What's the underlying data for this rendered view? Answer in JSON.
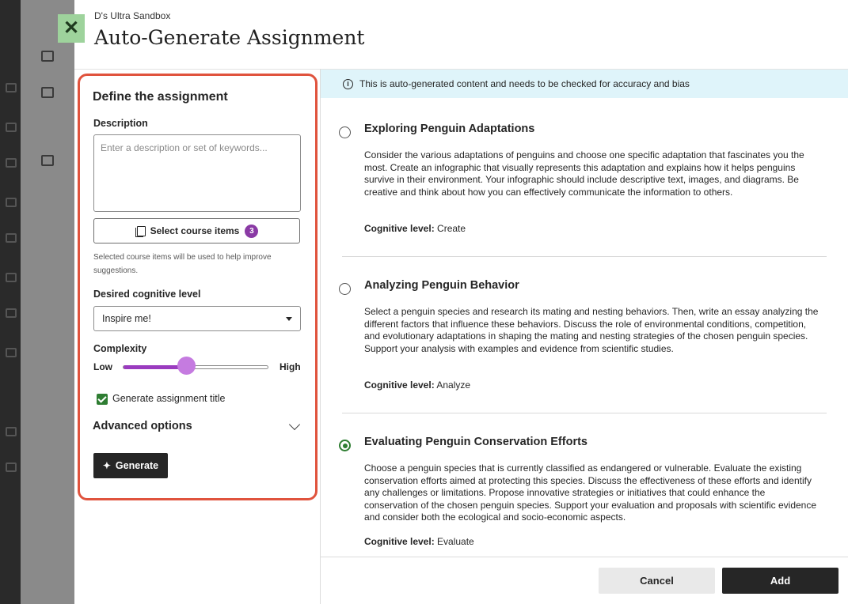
{
  "modal": {
    "course_name": "D's Ultra Sandbox",
    "title": "Auto-Generate Assignment"
  },
  "form": {
    "heading": "Define the assignment",
    "description_label": "Description",
    "description_placeholder": "Enter a description or set of keywords...",
    "description_value": "",
    "select_items_label": "Select course items",
    "select_items_count": "3",
    "helper_text": "Selected course items will be used to help improve suggestions.",
    "cognitive_label": "Desired cognitive level",
    "cognitive_value": "Inspire me!",
    "complexity_label": "Complexity",
    "complexity_low": "Low",
    "complexity_high": "High",
    "complexity_level": 0.44,
    "generate_title_label": "Generate assignment title",
    "generate_title_checked": true,
    "advanced_label": "Advanced options",
    "generate_button": "Generate"
  },
  "notice": {
    "text": "This is auto-generated content and needs to be checked for accuracy and bias",
    "icon": "info-icon"
  },
  "suggestions": [
    {
      "title": "Exploring Penguin Adaptations",
      "body": "Consider the various adaptations of penguins and choose one specific adaptation that fascinates you the most. Create an infographic that visually represents this adaptation and explains how it helps penguins survive in their environment. Your infographic should include descriptive text, images, and diagrams. Be creative and think about how you can effectively communicate the information to others.",
      "level_label": "Cognitive level:",
      "level_value": "Create",
      "selected": false
    },
    {
      "title": "Analyzing Penguin Behavior",
      "body": "Select a penguin species and research its mating and nesting behaviors. Then, write an essay analyzing the different factors that influence these behaviors. Discuss the role of environmental conditions, competition, and evolutionary adaptations in shaping the mating and nesting strategies of the chosen penguin species. Support your analysis with examples and evidence from scientific studies.",
      "level_label": "Cognitive level:",
      "level_value": "Analyze",
      "selected": false
    },
    {
      "title": "Evaluating Penguin Conservation Efforts",
      "body": "Choose a penguin species that is currently classified as endangered or vulnerable. Evaluate the existing conservation efforts aimed at protecting this species. Discuss the effectiveness of these efforts and identify any challenges or limitations. Propose innovative strategies or initiatives that could enhance the conservation of the chosen penguin species. Support your evaluation and proposals with scientific evidence and consider both the ecological and socio-economic aspects.",
      "level_label": "Cognitive level:",
      "level_value": "Evaluate",
      "selected": true
    }
  ],
  "footer": {
    "cancel_label": "Cancel",
    "add_label": "Add"
  },
  "colors": {
    "highlight_border": "#e0533d",
    "accent_purple": "#8a3aa5",
    "success_green": "#2e7d32",
    "notice_bg": "#dff4fa"
  }
}
